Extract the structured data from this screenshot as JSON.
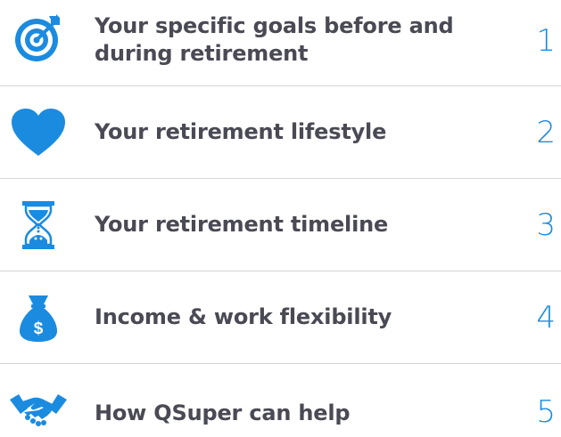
{
  "colors": {
    "accent": "#1b8be0",
    "text": "#4a4a55",
    "divider": "#d3d5d9"
  },
  "items": [
    {
      "icon": "target-icon",
      "label": "Your specific goals before and during retirement",
      "number": "1"
    },
    {
      "icon": "heart-icon",
      "label": "Your retirement lifestyle",
      "number": "2"
    },
    {
      "icon": "hourglass-icon",
      "label": "Your retirement timeline",
      "number": "3"
    },
    {
      "icon": "money-bag-icon",
      "label": "Income & work flexibility",
      "number": "4"
    },
    {
      "icon": "handshake-icon",
      "label": "How QSuper can help",
      "number": "5"
    }
  ],
  "money_bag_symbol": "$"
}
